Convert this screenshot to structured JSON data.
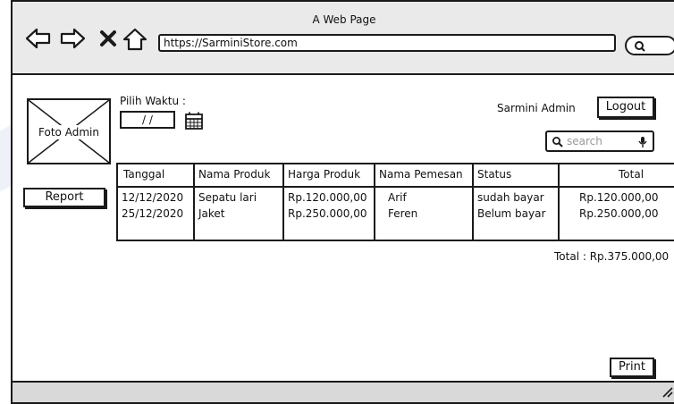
{
  "window": {
    "title": "A Web Page",
    "url": "https://SarminiStore.com"
  },
  "sidebar": {
    "photo_label": "Foto Admin",
    "report_label": "Report"
  },
  "filter": {
    "label": "Pilih Waktu :",
    "date_value": "/ /"
  },
  "header": {
    "user_name": "Sarmini Admin",
    "logout_label": "Logout",
    "search_placeholder": "search"
  },
  "table": {
    "headers": [
      "Tanggal",
      "Nama Produk",
      "Harga Produk",
      "Nama Pemesan",
      "Status",
      "Total"
    ],
    "rows": [
      [
        "12/12/2020",
        "Sepatu lari",
        "Rp.120.000,00",
        "Arif",
        "sudah bayar",
        "Rp.120.000,00"
      ],
      [
        "25/12/2020",
        "Jaket",
        "Rp.250.000,00",
        "Feren",
        "Belum bayar",
        "Rp.250.000,00"
      ]
    ]
  },
  "summary": {
    "total_text": "Total : Rp.375.000,00"
  },
  "footer": {
    "print_label": "Print"
  }
}
